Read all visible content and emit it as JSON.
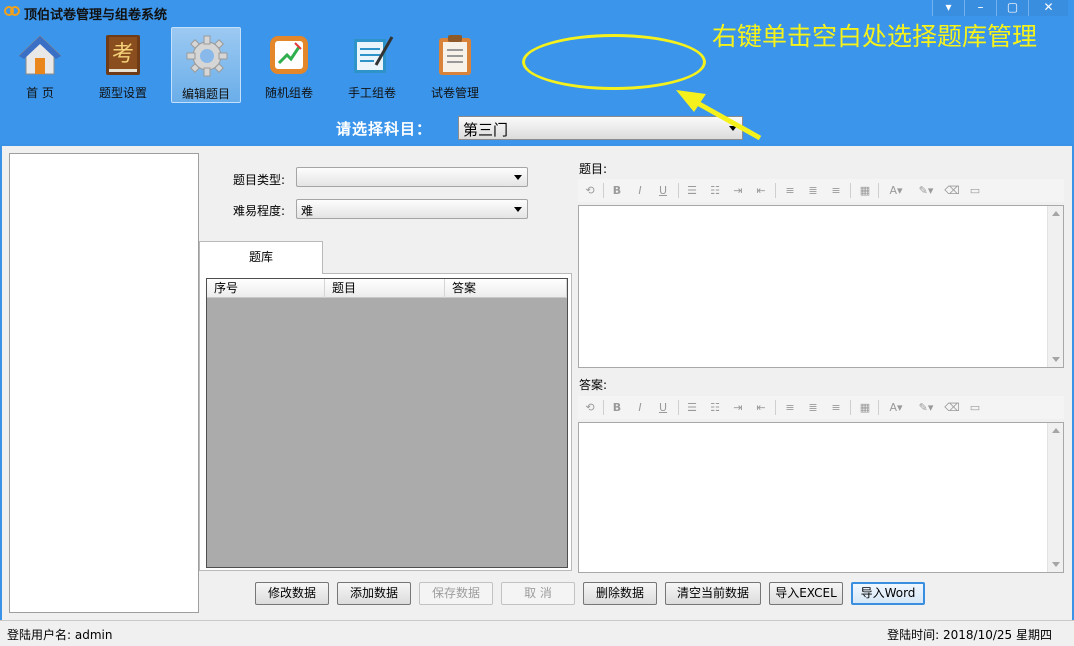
{
  "window": {
    "title": "顶伯试卷管理与组卷系统",
    "controls": [
      "▾",
      "–",
      "▢",
      "✕"
    ]
  },
  "toolbar": {
    "items": [
      {
        "label": "首  页",
        "icon": "home-icon"
      },
      {
        "label": "题型设置",
        "icon": "exam-book-icon"
      },
      {
        "label": "编辑题目",
        "icon": "gear-icon"
      },
      {
        "label": "随机组卷",
        "icon": "whiteboard-icon"
      },
      {
        "label": "手工组卷",
        "icon": "notepad-pen-icon"
      },
      {
        "label": "试卷管理",
        "icon": "clipboard-icon"
      }
    ],
    "active_index": 2
  },
  "annotation": {
    "text": "右键单击空白处选择题库管理",
    "color": "#f6f21a"
  },
  "subject": {
    "label": "请选择科目：",
    "value": "第三门"
  },
  "filters": {
    "type_label": "题目类型:",
    "type_value": "",
    "difficulty_label": "难易程度:",
    "difficulty_value": "难"
  },
  "tab": {
    "label": "题库"
  },
  "grid": {
    "columns": [
      "序号",
      "题目",
      "答案"
    ],
    "rows": []
  },
  "editor": {
    "question_label": "题目:",
    "answer_label": "答案:",
    "toolbar_buttons": [
      "⟲",
      "B",
      "I",
      "U",
      "☰",
      "☷",
      "⇥",
      "⇤",
      "≡",
      "≣",
      "≡",
      "▦",
      "A▾",
      "✎▾",
      "⌫",
      "▭"
    ]
  },
  "buttons": [
    {
      "label": "修改数据",
      "enabled": true
    },
    {
      "label": "添加数据",
      "enabled": true
    },
    {
      "label": "保存数据",
      "enabled": false
    },
    {
      "label": "取  消",
      "enabled": false
    },
    {
      "label": "删除数据",
      "enabled": true
    },
    {
      "label": "清空当前数据",
      "enabled": true
    },
    {
      "label": "导入EXCEL",
      "enabled": true
    },
    {
      "label": "导入Word",
      "enabled": true
    }
  ],
  "status": {
    "user_label": "登陆用户名:",
    "user": "admin",
    "time_label": "登陆时间:",
    "time": "2018/10/25 星期四"
  },
  "colors": {
    "title_bar": "#3b95ea",
    "content_bg": "#f0f0f0",
    "grid_bg": "#ababab",
    "accent": "#3a8ee0"
  }
}
